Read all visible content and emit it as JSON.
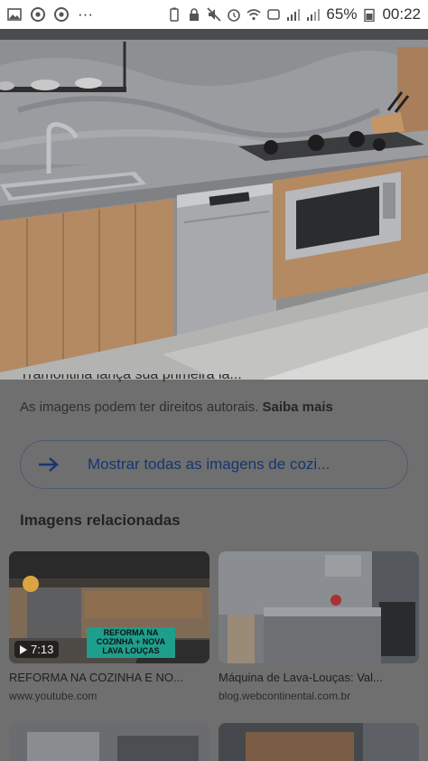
{
  "status_bar": {
    "battery": "65%",
    "time": "00:22",
    "more": "···"
  },
  "page": {
    "cut_title": "Tramontina lança sua primeira lá...",
    "rights_text": "As imagens podem ter direitos autorais.",
    "rights_link": "Saiba mais",
    "show_all_label": "Mostrar todas as imagens de cozi...",
    "related_heading": "Imagens relacionadas"
  },
  "related": [
    {
      "caption": "REFORMA NA COZINHA E NO...",
      "source": "www.youtube.com",
      "duration": "7:13",
      "banner": "REFORMA NA COZINHA + NOVA LAVA LOUÇAS"
    },
    {
      "caption": "Máquina de Lava-Louças: Val...",
      "source": "blog.webcontinental.com.br"
    }
  ],
  "colors": {
    "link": "#17366f",
    "scrim": "#6f6f6f",
    "cabinet": "#b48a63"
  }
}
